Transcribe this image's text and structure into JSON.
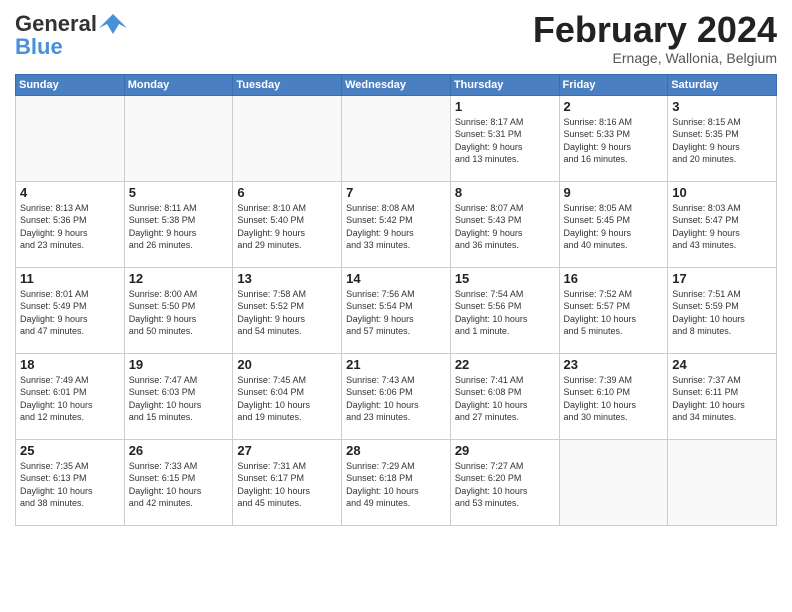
{
  "header": {
    "logo_general": "General",
    "logo_blue": "Blue",
    "month_title": "February 2024",
    "location": "Ernage, Wallonia, Belgium"
  },
  "days_of_week": [
    "Sunday",
    "Monday",
    "Tuesday",
    "Wednesday",
    "Thursday",
    "Friday",
    "Saturday"
  ],
  "weeks": [
    [
      {
        "day": "",
        "info": ""
      },
      {
        "day": "",
        "info": ""
      },
      {
        "day": "",
        "info": ""
      },
      {
        "day": "",
        "info": ""
      },
      {
        "day": "1",
        "info": "Sunrise: 8:17 AM\nSunset: 5:31 PM\nDaylight: 9 hours\nand 13 minutes."
      },
      {
        "day": "2",
        "info": "Sunrise: 8:16 AM\nSunset: 5:33 PM\nDaylight: 9 hours\nand 16 minutes."
      },
      {
        "day": "3",
        "info": "Sunrise: 8:15 AM\nSunset: 5:35 PM\nDaylight: 9 hours\nand 20 minutes."
      }
    ],
    [
      {
        "day": "4",
        "info": "Sunrise: 8:13 AM\nSunset: 5:36 PM\nDaylight: 9 hours\nand 23 minutes."
      },
      {
        "day": "5",
        "info": "Sunrise: 8:11 AM\nSunset: 5:38 PM\nDaylight: 9 hours\nand 26 minutes."
      },
      {
        "day": "6",
        "info": "Sunrise: 8:10 AM\nSunset: 5:40 PM\nDaylight: 9 hours\nand 29 minutes."
      },
      {
        "day": "7",
        "info": "Sunrise: 8:08 AM\nSunset: 5:42 PM\nDaylight: 9 hours\nand 33 minutes."
      },
      {
        "day": "8",
        "info": "Sunrise: 8:07 AM\nSunset: 5:43 PM\nDaylight: 9 hours\nand 36 minutes."
      },
      {
        "day": "9",
        "info": "Sunrise: 8:05 AM\nSunset: 5:45 PM\nDaylight: 9 hours\nand 40 minutes."
      },
      {
        "day": "10",
        "info": "Sunrise: 8:03 AM\nSunset: 5:47 PM\nDaylight: 9 hours\nand 43 minutes."
      }
    ],
    [
      {
        "day": "11",
        "info": "Sunrise: 8:01 AM\nSunset: 5:49 PM\nDaylight: 9 hours\nand 47 minutes."
      },
      {
        "day": "12",
        "info": "Sunrise: 8:00 AM\nSunset: 5:50 PM\nDaylight: 9 hours\nand 50 minutes."
      },
      {
        "day": "13",
        "info": "Sunrise: 7:58 AM\nSunset: 5:52 PM\nDaylight: 9 hours\nand 54 minutes."
      },
      {
        "day": "14",
        "info": "Sunrise: 7:56 AM\nSunset: 5:54 PM\nDaylight: 9 hours\nand 57 minutes."
      },
      {
        "day": "15",
        "info": "Sunrise: 7:54 AM\nSunset: 5:56 PM\nDaylight: 10 hours\nand 1 minute."
      },
      {
        "day": "16",
        "info": "Sunrise: 7:52 AM\nSunset: 5:57 PM\nDaylight: 10 hours\nand 5 minutes."
      },
      {
        "day": "17",
        "info": "Sunrise: 7:51 AM\nSunset: 5:59 PM\nDaylight: 10 hours\nand 8 minutes."
      }
    ],
    [
      {
        "day": "18",
        "info": "Sunrise: 7:49 AM\nSunset: 6:01 PM\nDaylight: 10 hours\nand 12 minutes."
      },
      {
        "day": "19",
        "info": "Sunrise: 7:47 AM\nSunset: 6:03 PM\nDaylight: 10 hours\nand 15 minutes."
      },
      {
        "day": "20",
        "info": "Sunrise: 7:45 AM\nSunset: 6:04 PM\nDaylight: 10 hours\nand 19 minutes."
      },
      {
        "day": "21",
        "info": "Sunrise: 7:43 AM\nSunset: 6:06 PM\nDaylight: 10 hours\nand 23 minutes."
      },
      {
        "day": "22",
        "info": "Sunrise: 7:41 AM\nSunset: 6:08 PM\nDaylight: 10 hours\nand 27 minutes."
      },
      {
        "day": "23",
        "info": "Sunrise: 7:39 AM\nSunset: 6:10 PM\nDaylight: 10 hours\nand 30 minutes."
      },
      {
        "day": "24",
        "info": "Sunrise: 7:37 AM\nSunset: 6:11 PM\nDaylight: 10 hours\nand 34 minutes."
      }
    ],
    [
      {
        "day": "25",
        "info": "Sunrise: 7:35 AM\nSunset: 6:13 PM\nDaylight: 10 hours\nand 38 minutes."
      },
      {
        "day": "26",
        "info": "Sunrise: 7:33 AM\nSunset: 6:15 PM\nDaylight: 10 hours\nand 42 minutes."
      },
      {
        "day": "27",
        "info": "Sunrise: 7:31 AM\nSunset: 6:17 PM\nDaylight: 10 hours\nand 45 minutes."
      },
      {
        "day": "28",
        "info": "Sunrise: 7:29 AM\nSunset: 6:18 PM\nDaylight: 10 hours\nand 49 minutes."
      },
      {
        "day": "29",
        "info": "Sunrise: 7:27 AM\nSunset: 6:20 PM\nDaylight: 10 hours\nand 53 minutes."
      },
      {
        "day": "",
        "info": ""
      },
      {
        "day": "",
        "info": ""
      }
    ]
  ]
}
